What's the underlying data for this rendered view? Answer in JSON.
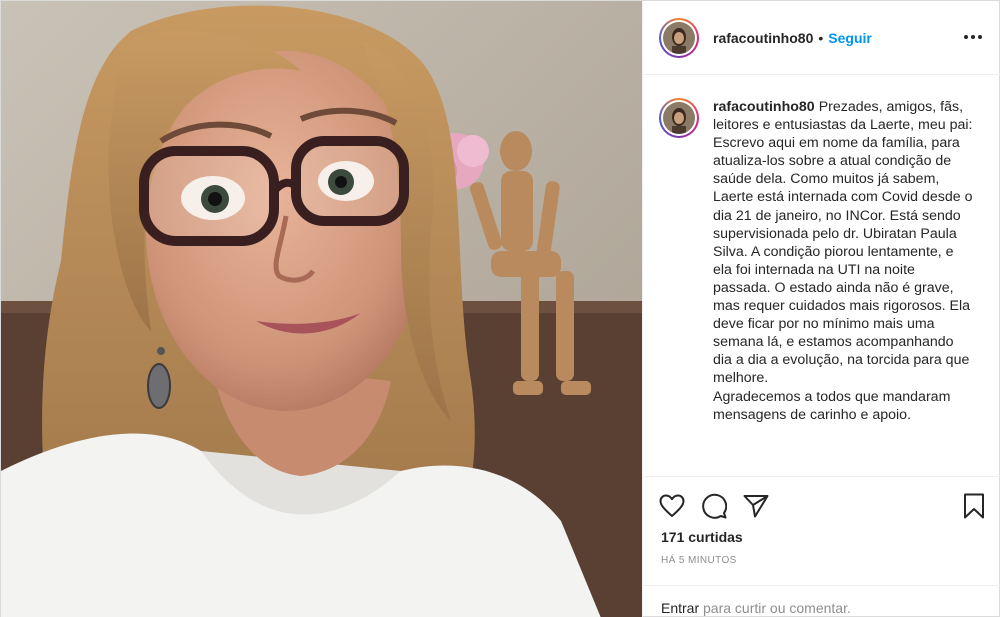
{
  "post": {
    "username": "rafacoutinho80",
    "separator": "•",
    "follow_label": "Seguir",
    "more_icon": "more-horizontal-icon",
    "caption": {
      "username": "rafacoutinho80",
      "paragraphs": [
        "Prezades, amigos, fãs, leitores e entusiastas da Laerte, meu pai:",
        "Escrevo aqui em nome da família, para atualiza-los sobre a atual condição de saúde dela. Como muitos já sabem, Laerte está internada com Covid desde o dia 21 de janeiro, no INCor. Está sendo supervisionada pelo dr. Ubiratan Paula Silva. A condição piorou lentamente, e ela foi internada na UTI na noite passada. O estado ainda não é grave, mas requer cuidados mais rigorosos. Ela deve ficar por no mínimo mais uma semana lá, e estamos acompanhando dia a dia a evolução, na torcida para que melhore.",
        "Agradecemos a todos que mandaram mensagens de carinho e apoio."
      ]
    },
    "actions": {
      "like_icon": "heart-icon",
      "comment_icon": "comment-icon",
      "share_icon": "paper-plane-icon",
      "save_icon": "bookmark-icon"
    },
    "likes": "171 curtidas",
    "time": "HÁ 5 MINUTOS",
    "comment_bar": {
      "login": "Entrar",
      "rest": " para curtir ou comentar."
    }
  },
  "colors": {
    "accent": "#0095f6",
    "text": "#262626",
    "muted": "#8e8e8e",
    "border": "#efefef"
  }
}
